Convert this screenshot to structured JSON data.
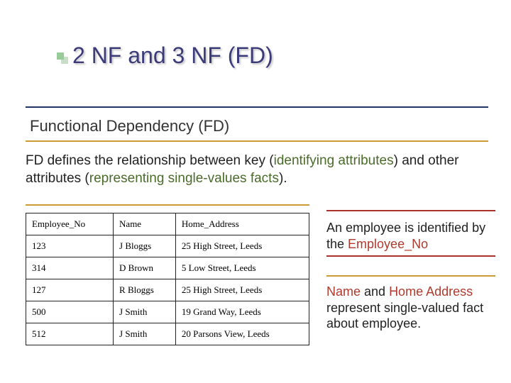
{
  "title": "2 NF and 3 NF (FD)",
  "subtitle": "Functional Dependency (FD)",
  "definition": {
    "pre": "FD defines the relationship between key (",
    "term1": "identifying attributes",
    "mid": ") and other attributes (",
    "term2": "representing single-values facts",
    "post": ")."
  },
  "table": {
    "headers": [
      "Employee_No",
      "Name",
      "Home_Address"
    ],
    "rows": [
      [
        "123",
        "J Bloggs",
        "25 High Street, Leeds"
      ],
      [
        "314",
        "D Brown",
        "5 Low Street, Leeds"
      ],
      [
        "127",
        "R Bloggs",
        "25 High Street, Leeds"
      ],
      [
        "500",
        "J Smith",
        "19 Grand Way, Leeds"
      ],
      [
        "512",
        "J Smith",
        "20 Parsons View, Leeds"
      ]
    ]
  },
  "note1": {
    "pre": "An employee is identified by the ",
    "hl": "Employee_No"
  },
  "note2": {
    "hl1": "Name",
    "mid": " and ",
    "hl2": "Home Address",
    "post": " represent single-valued fact about employee."
  }
}
